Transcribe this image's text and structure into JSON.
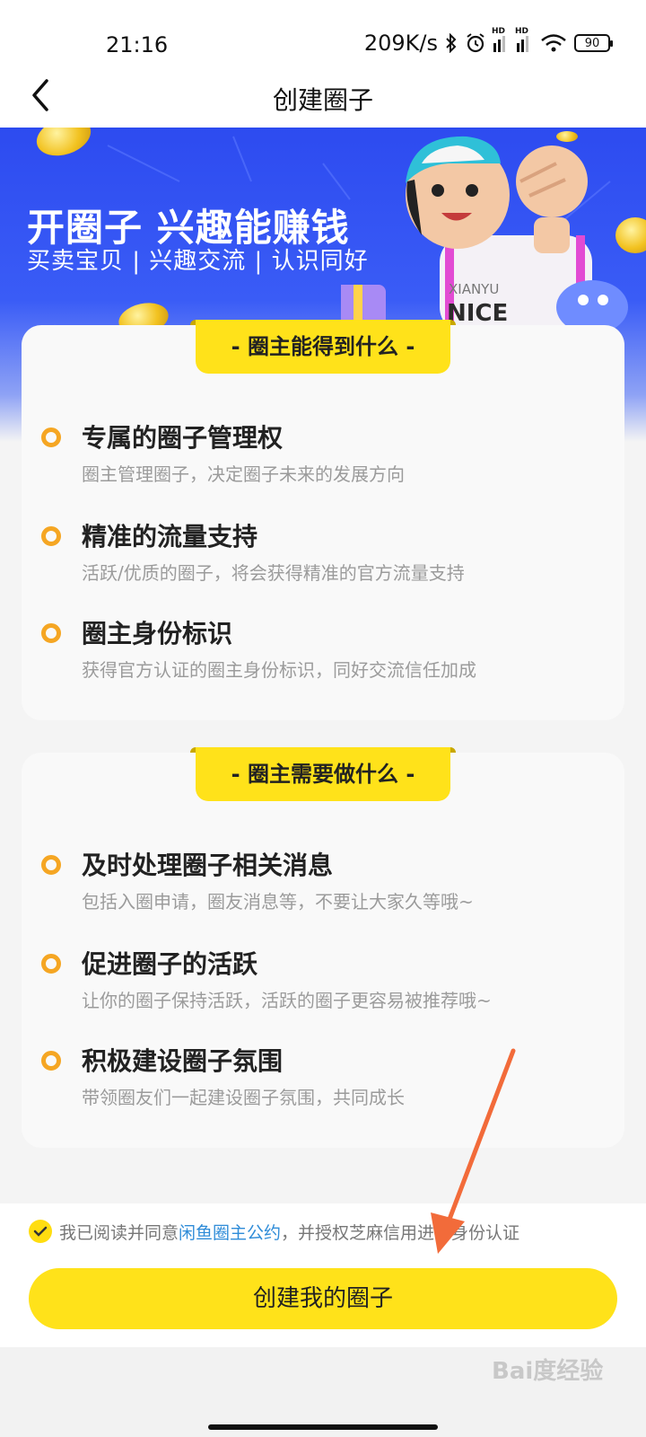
{
  "status": {
    "time": "21:16",
    "speed": "209K/s",
    "battery": "90",
    "icons": [
      "bluetooth-icon",
      "alarm-icon",
      "signal-icon",
      "signal-icon",
      "wifi-icon",
      "battery-icon"
    ],
    "hd_label": "HD"
  },
  "nav": {
    "title": "创建圈子",
    "back_icon": "back-arrow-icon"
  },
  "banner": {
    "title": "开圈子 兴趣能赚钱",
    "subtitle": "买卖宝贝 | 兴趣交流 | 认识同好",
    "mascot_shirt_text": "XIANYU NICE"
  },
  "sections": [
    {
      "tag": "- 圈主能得到什么 -",
      "items": [
        {
          "title": "专属的圈子管理权",
          "desc": "圈主管理圈子，决定圈子未来的发展方向"
        },
        {
          "title": "精准的流量支持",
          "desc": "活跃/优质的圈子，将会获得精准的官方流量支持"
        },
        {
          "title": "圈主身份标识",
          "desc": "获得官方认证的圈主身份标识，同好交流信任加成"
        }
      ]
    },
    {
      "tag": "- 圈主需要做什么 -",
      "items": [
        {
          "title": "及时处理圈子相关消息",
          "desc": "包括入圈申请，圈友消息等，不要让大家久等哦~"
        },
        {
          "title": "促进圈子的活跃",
          "desc": "让你的圈子保持活跃，活跃的圈子更容易被推荐哦~"
        },
        {
          "title": "积极建设圈子氛围",
          "desc": "带领圈友们一起建设圈子氛围，共同成长"
        }
      ]
    }
  ],
  "footer": {
    "agree_prefix": "我已阅读并同意",
    "agree_link": "闲鱼圈主公约",
    "agree_suffix": "，并授权芝麻信用进行身份认证",
    "button_label": "创建我的圈子"
  },
  "watermark": "Bai度经验",
  "colors": {
    "accent_yellow": "#ffe21a",
    "bullet_orange": "#f5a623",
    "banner_blue": "#2d4bf0",
    "link_blue": "#2f8cd8"
  }
}
